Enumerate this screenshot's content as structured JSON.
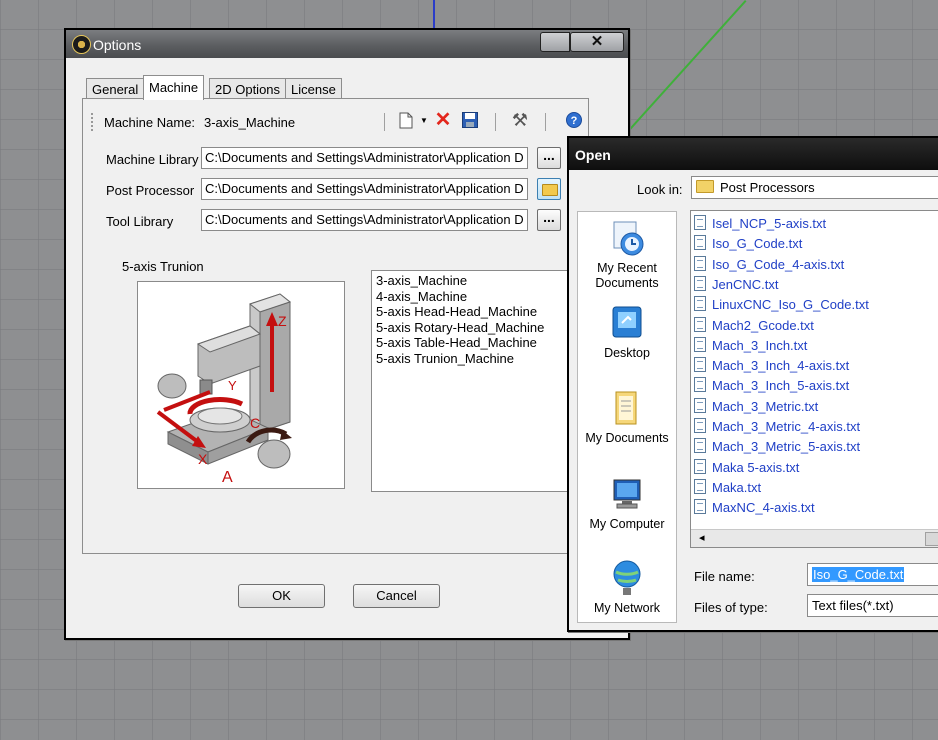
{
  "options_dialog": {
    "title": "Options",
    "close_glyph": "✕",
    "tabs": [
      "General",
      "Machine",
      "2D Options",
      "License"
    ],
    "active_tab": "Machine",
    "machine_name_label": "Machine Name:",
    "machine_name_value": "3-axis_Machine",
    "toolbar_icons": [
      "new-document-icon",
      "dropdown-arrow-icon",
      "delete-icon",
      "save-icon",
      "tools-icon",
      "help-icon"
    ],
    "fields": [
      {
        "label": "Machine Library",
        "value": "C:\\Documents and Settings\\Administrator\\Application D",
        "button": "..."
      },
      {
        "label": "Post Processor",
        "value": "C:\\Documents and Settings\\Administrator\\Application D",
        "button": "folder"
      },
      {
        "label": "Tool Library",
        "value": "C:\\Documents and Settings\\Administrator\\Application D",
        "button": "..."
      }
    ],
    "preview_label": "5-axis Trunion",
    "preview_axis_labels": [
      "Z",
      "Y",
      "C",
      "X",
      "A"
    ],
    "machines": [
      "3-axis_Machine",
      "4-axis_Machine",
      "5-axis Head-Head_Machine",
      "5-axis Rotary-Head_Machine",
      "5-axis Table-Head_Machine",
      "5-axis Trunion_Machine"
    ],
    "ok_label": "OK",
    "cancel_label": "Cancel"
  },
  "open_dialog": {
    "title": "Open",
    "look_in_label": "Look in:",
    "look_in_value": "Post Processors",
    "places": [
      {
        "label": "My Recent Documents",
        "icon": "recent-documents-icon"
      },
      {
        "label": "Desktop",
        "icon": "desktop-icon"
      },
      {
        "label": "My Documents",
        "icon": "my-documents-icon"
      },
      {
        "label": "My Computer",
        "icon": "my-computer-icon"
      },
      {
        "label": "My Network",
        "icon": "my-network-icon"
      }
    ],
    "files": [
      "Isel_NCP_5-axis.txt",
      "Iso_G_Code.txt",
      "Iso_G_Code_4-axis.txt",
      "JenCNC.txt",
      "LinuxCNC_Iso_G_Code.txt",
      "Mach2_Gcode.txt",
      "Mach_3_Inch.txt",
      "Mach_3_Inch_4-axis.txt",
      "Mach_3_Inch_5-axis.txt",
      "Mach_3_Metric.txt",
      "Mach_3_Metric_4-axis.txt",
      "Mach_3_Metric_5-axis.txt",
      "Maka 5-axis.txt",
      "Maka.txt",
      "MaxNC_4-axis.txt"
    ],
    "file_name_label": "File name:",
    "file_name_value": "Iso_G_Code.txt",
    "files_of_type_label": "Files of type:",
    "files_of_type_value": "Text files(*.txt)",
    "scroll_left_glyph": "◂"
  }
}
